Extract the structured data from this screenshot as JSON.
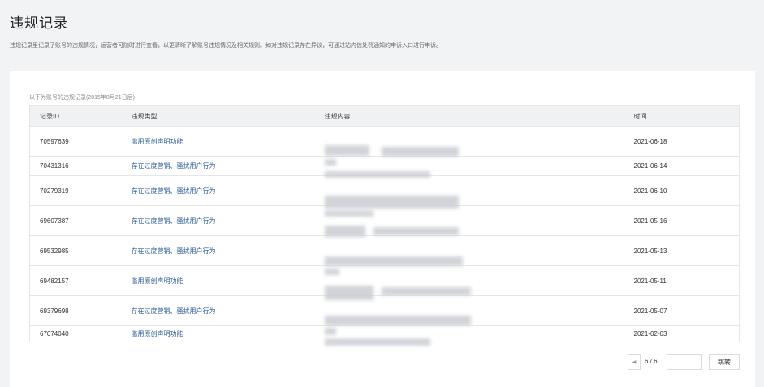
{
  "page": {
    "title": "违规记录",
    "description": "违规记录里记录了账号的违规情况，运营者可随时进行查看，以更清晰了解账号违规情况及相关规则。如对违规记录存在异议，可通过站内信处罚通知的申诉入口进行申诉。"
  },
  "table": {
    "caption": "以下为账号的违规记录(2015年8月21日后)",
    "columns": [
      "记录ID",
      "违规类型",
      "违规内容",
      "时间"
    ],
    "rows": [
      {
        "id": "70597639",
        "type": "滥用原创声明功能",
        "content": "",
        "time": "2021-06-18"
      },
      {
        "id": "70431316",
        "type": "存在过度营销、骚扰用户行为",
        "content": "",
        "time": "2021-06-14"
      },
      {
        "id": "70279319",
        "type": "存在过度营销、骚扰用户行为",
        "content": "",
        "time": "2021-06-10"
      },
      {
        "id": "69607387",
        "type": "存在过度营销、骚扰用户行为",
        "content": "",
        "time": "2021-05-16"
      },
      {
        "id": "69532985",
        "type": "存在过度营销、骚扰用户行为",
        "content": "",
        "time": "2021-05-13"
      },
      {
        "id": "69482157",
        "type": "滥用原创声明功能",
        "content": "",
        "time": "2021-05-11"
      },
      {
        "id": "69379698",
        "type": "存在过度营销、骚扰用户行为",
        "content": "",
        "time": "2021-05-07"
      },
      {
        "id": "67074040",
        "type": "滥用原创声明功能",
        "content": "",
        "time": "2021-02-03"
      }
    ]
  },
  "pagination": {
    "prev_icon": "chevron-left-icon",
    "current_page": 6,
    "total_pages": 6,
    "indicator": "6 / 6",
    "jump_input_value": "",
    "jump_label": "跳转"
  },
  "colors": {
    "background": "#f2f3f5",
    "card": "#ffffff",
    "link": "#2f5f9a",
    "header_row": "#f0f1f3"
  }
}
